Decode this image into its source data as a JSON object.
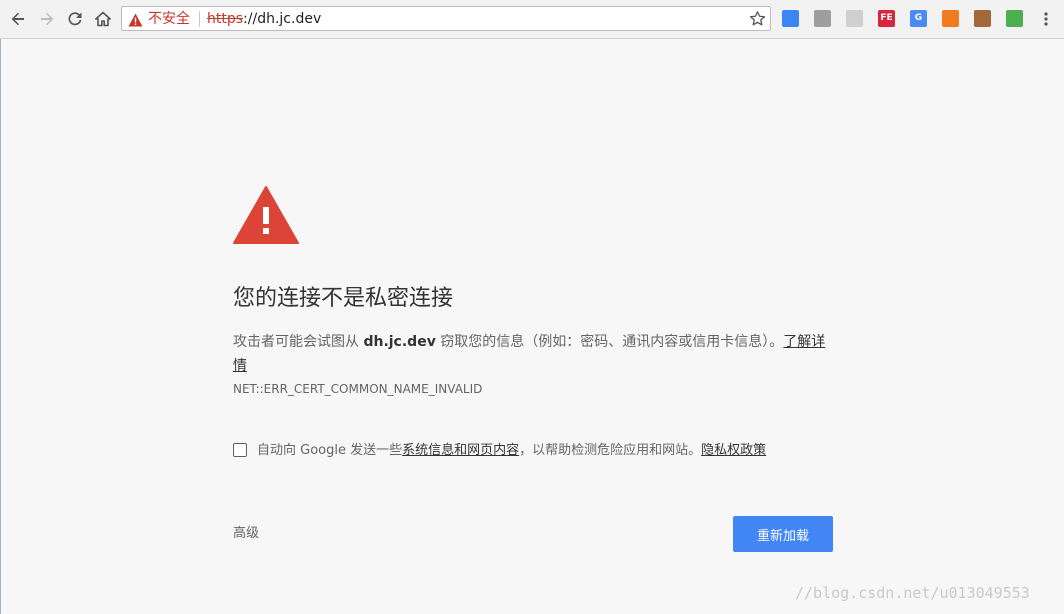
{
  "browser": {
    "security_label": "不安全",
    "url_scheme": "https",
    "url_rest": "://dh.jc.dev",
    "extensions": [
      {
        "name": "download-extension-icon",
        "color": "#3b86f5",
        "text": ""
      },
      {
        "name": "user-extension-icon",
        "color": "#9e9e9e",
        "text": ""
      },
      {
        "name": "pen-extension-icon",
        "color": "#cfcfcf",
        "text": ""
      },
      {
        "name": "fe-extension-icon",
        "color": "#d7263d",
        "text": "FE"
      },
      {
        "name": "translate-extension-icon",
        "color": "#4a8af4",
        "text": "G"
      },
      {
        "name": "grid-extension-icon",
        "color": "#f07c22",
        "text": ""
      },
      {
        "name": "monkey-extension-icon",
        "color": "#a3683a",
        "text": ""
      },
      {
        "name": "colorful-extension-icon",
        "color": "#4caf50",
        "text": ""
      }
    ]
  },
  "interstitial": {
    "heading": "您的连接不是私密连接",
    "explanation_prefix": "攻击者可能会试图从 ",
    "host": "dh.jc.dev",
    "explanation_suffix": " 窃取您的信息（例如：密码、通讯内容或信用卡信息）。",
    "learn_more": "了解详情",
    "error_code": "NET::ERR_CERT_COMMON_NAME_INVALID",
    "optin_prefix": "自动向 Google 发送一些",
    "optin_link": "系统信息和网页内容",
    "optin_middle": "，以帮助检测危险应用和网站。",
    "privacy_link": "隐私权政策",
    "advanced_label": "高级",
    "reload_label": "重新加载"
  },
  "watermark": "//blog.csdn.net/u013049553",
  "colors": {
    "warning_red": "#db4437",
    "primary_blue": "#4285f4"
  }
}
